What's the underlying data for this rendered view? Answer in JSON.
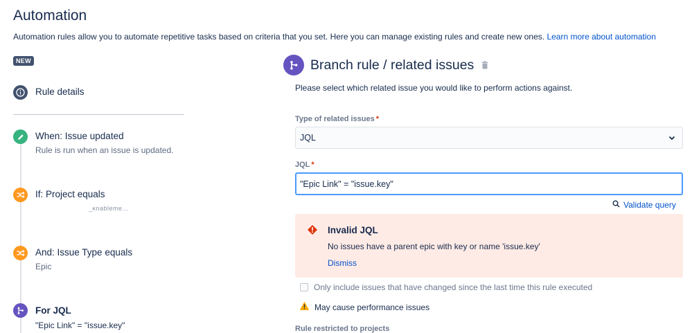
{
  "page": {
    "title": "Automation",
    "description": "Automation rules allow you to automate repetitive tasks based on criteria that you set. Here you can manage existing rules and create new ones.",
    "learn_more_link": "Learn more about automation"
  },
  "badge": {
    "label": "NEW"
  },
  "sidebar": {
    "rule_details": {
      "title": "Rule details",
      "icon": "info-icon"
    },
    "steps": [
      {
        "title": "When: Issue updated",
        "subtitle": "Rule is run when an issue is updated.",
        "icon": "pencil-icon"
      },
      {
        "title": "If: Project equals",
        "subtitle": "_ĸnableme...",
        "icon": "shuffle-icon"
      },
      {
        "title": "And: Issue Type equals",
        "subtitle": "Epic",
        "icon": "shuffle-icon"
      },
      {
        "title": "For JQL",
        "subtitle": "\"Epic Link\" = \"issue.key\"",
        "icon": "branch-icon"
      }
    ]
  },
  "branch": {
    "title": "Branch rule / related issues",
    "description": "Please select which related issue you would like to perform actions against.",
    "type_label": "Type of related issues",
    "type_value": "JQL",
    "jql_label": "JQL",
    "jql_value": "\"Epic Link\" = \"issue.key\"",
    "validate_label": "Validate query",
    "error": {
      "title": "Invalid JQL",
      "message": "No issues have a parent epic with key or name 'issue.key'",
      "dismiss": "Dismiss"
    },
    "checkbox_label": "Only include issues that have changed since the last time this rule executed",
    "checkbox_checked": false,
    "warning": "May cause performance issues",
    "restricted_label": "Rule restricted to projects"
  },
  "colors": {
    "link": "#0052cc",
    "purple": "#6554c0",
    "green": "#36b37e",
    "orange": "#ff991f",
    "error_bg": "#ffebe6",
    "error_icon": "#de350b",
    "warning": "#ffab00"
  }
}
